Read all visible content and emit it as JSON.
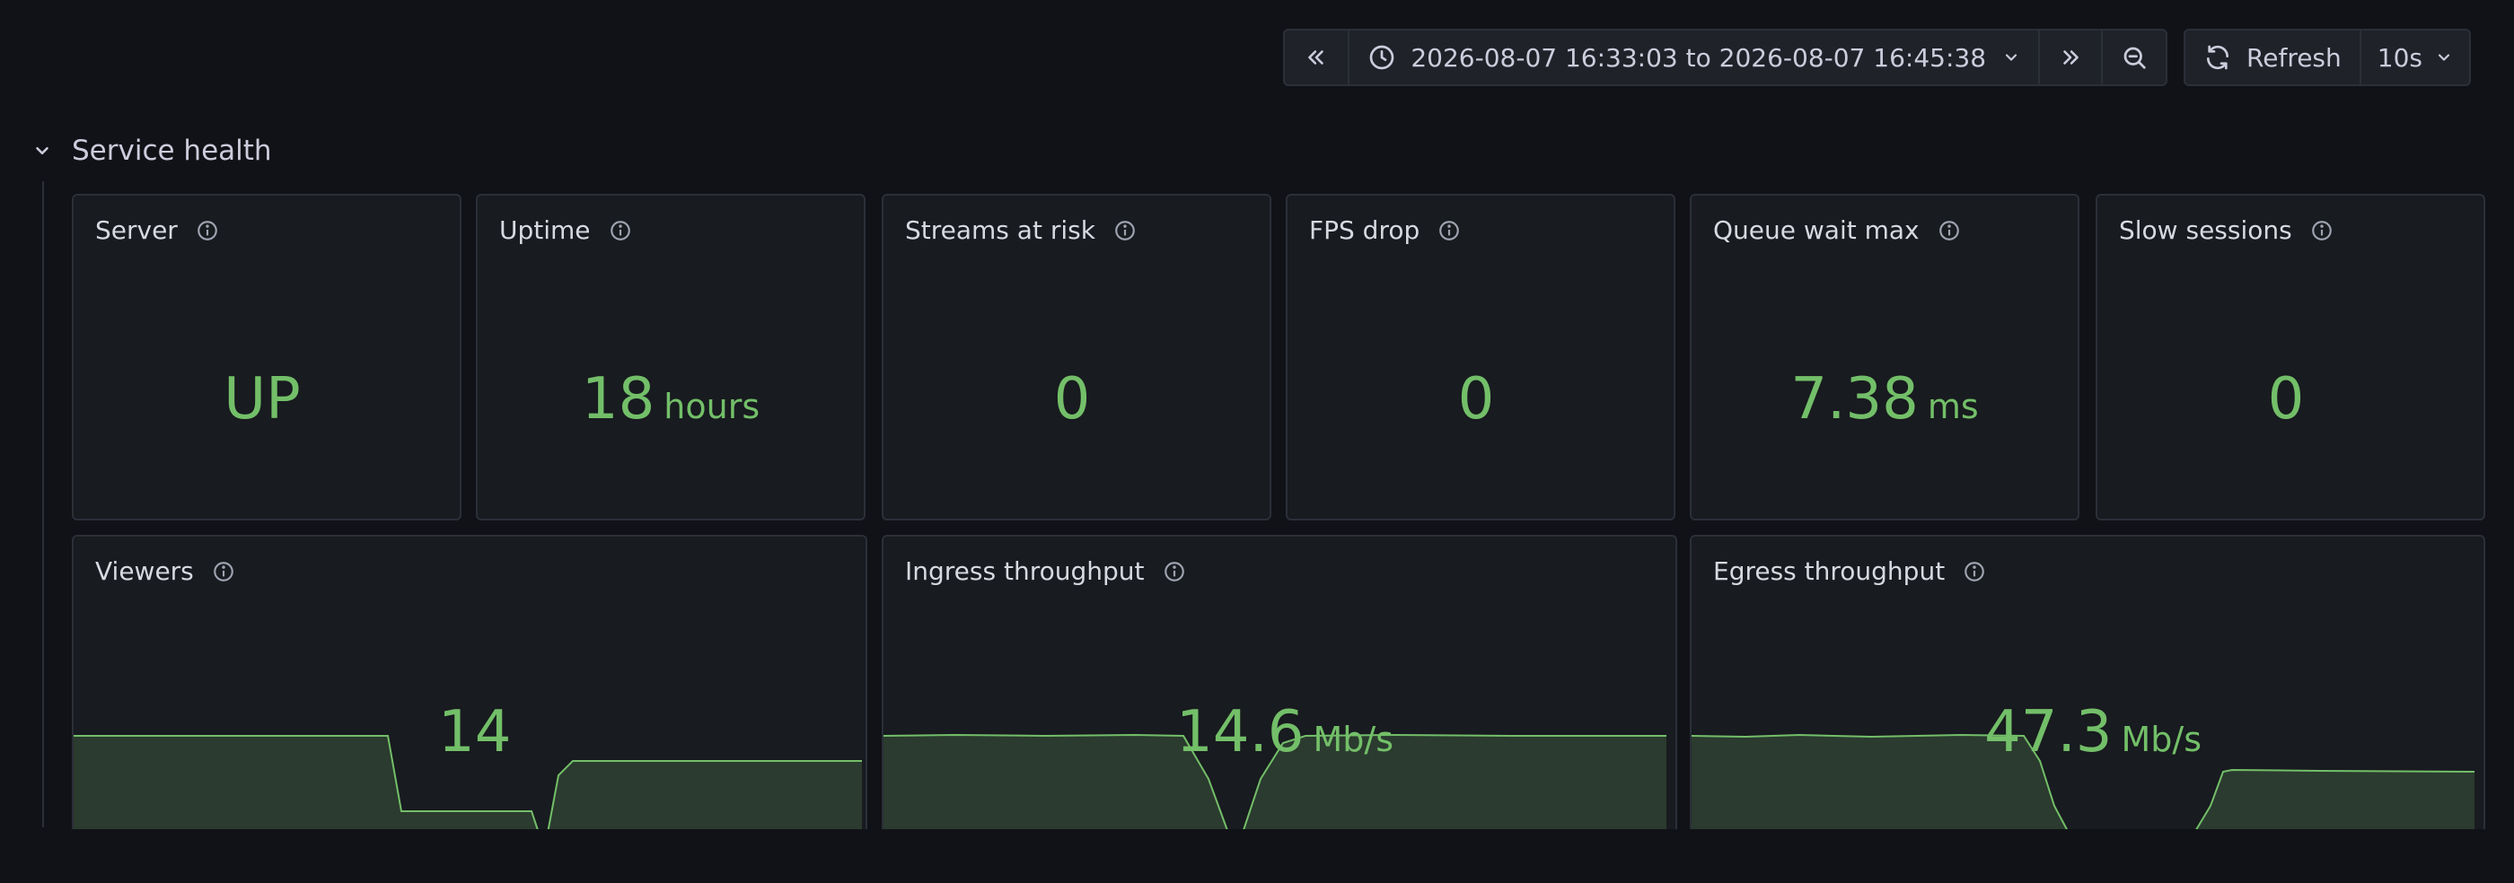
{
  "toolbar": {
    "time_range": "2026-08-07 16:33:03 to 2026-08-07 16:45:38",
    "refresh_label": "Refresh",
    "refresh_interval": "10s"
  },
  "row": {
    "title": "Service health"
  },
  "stats": [
    {
      "title": "Server",
      "value": "UP",
      "unit": ""
    },
    {
      "title": "Uptime",
      "value": "18",
      "unit": "hours"
    },
    {
      "title": "Streams at risk",
      "value": "0",
      "unit": ""
    },
    {
      "title": "FPS drop",
      "value": "0",
      "unit": ""
    },
    {
      "title": "Queue wait max",
      "value": "7.38",
      "unit": "ms"
    },
    {
      "title": "Slow sessions",
      "value": "0",
      "unit": ""
    }
  ],
  "timeseries": [
    {
      "title": "Viewers",
      "value": "14",
      "unit": ""
    },
    {
      "title": "Ingress throughput",
      "value": "14.6",
      "unit": "Mb/s"
    },
    {
      "title": "Egress throughput",
      "value": "47.3",
      "unit": "Mb/s"
    }
  ],
  "colors": {
    "value": "#73bf69",
    "series_fill": "#2b3b2f",
    "background": "#111217",
    "panel": "#181b1f"
  }
}
